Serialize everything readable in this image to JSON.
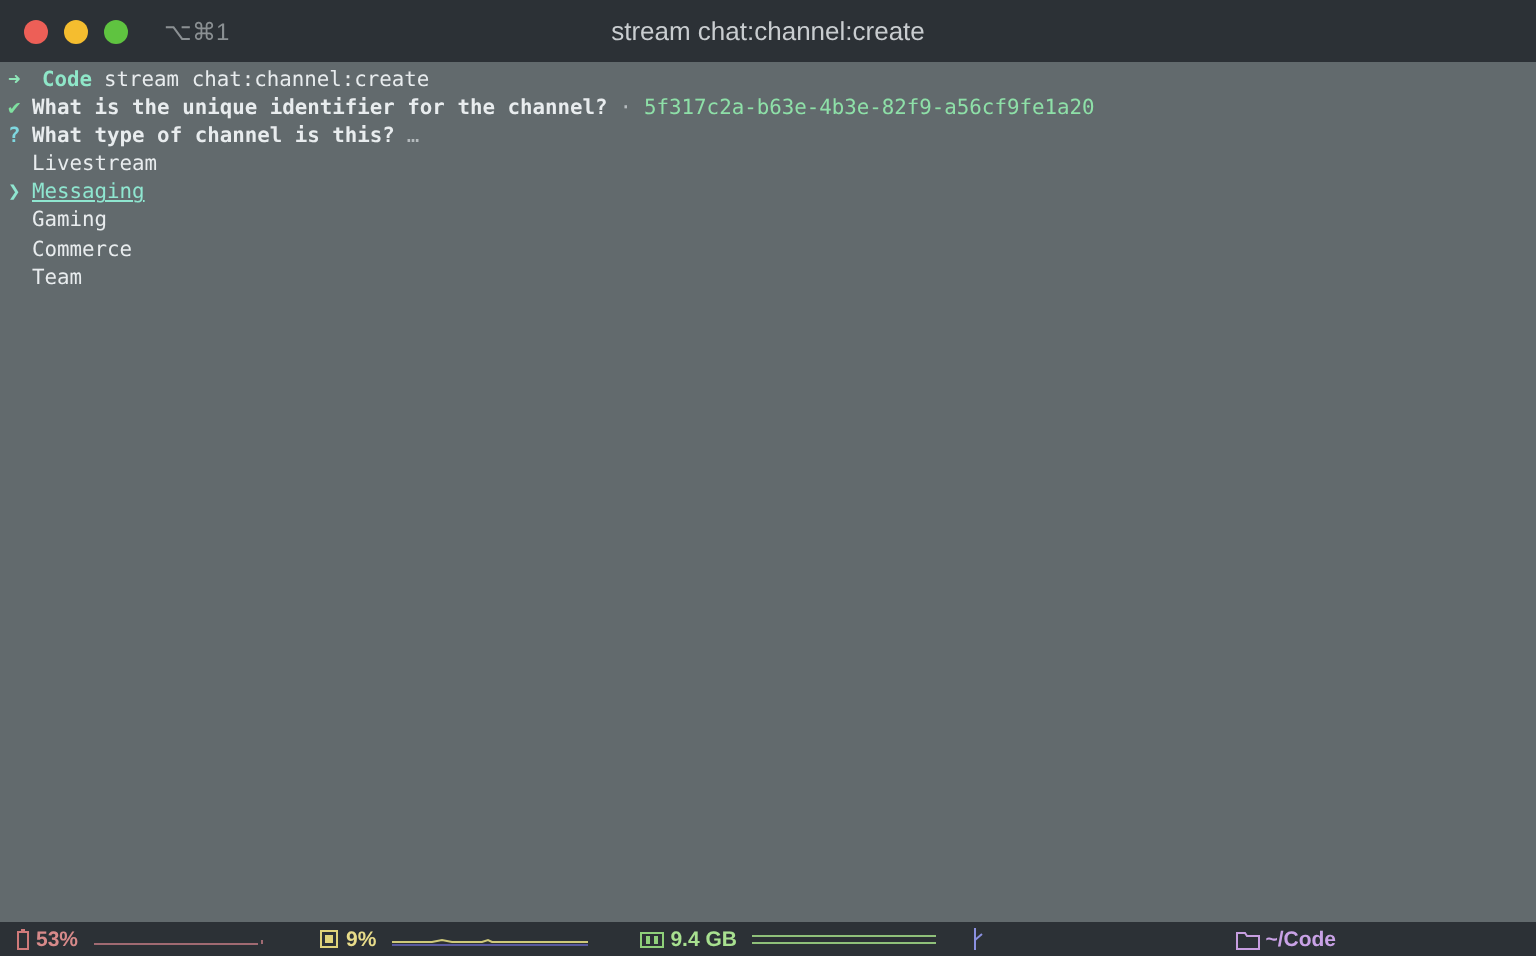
{
  "window": {
    "title": "stream chat:channel:create",
    "shortcut": "⌥⌘1"
  },
  "prompt": {
    "arrow": "➜",
    "directory": "Code",
    "command": "stream chat:channel:create"
  },
  "questions": [
    {
      "kind": "answered",
      "mark": "✔",
      "text": "What is the unique identifier for the channel?",
      "separator": "·",
      "answer": "5f317c2a-b63e-4b3e-82f9-a56cf9fe1a20"
    },
    {
      "kind": "pending",
      "mark": "?",
      "text": "What type of channel is this?",
      "separator": "…"
    }
  ],
  "pointer": "❯",
  "options": [
    {
      "label": "Livestream",
      "selected": false
    },
    {
      "label": "Messaging",
      "selected": true
    },
    {
      "label": "Gaming",
      "selected": false
    },
    {
      "label": "Commerce",
      "selected": false
    },
    {
      "label": "Team",
      "selected": false
    }
  ],
  "status_bar": {
    "battery": "53%",
    "cpu": "9%",
    "memory": "9.4 GB",
    "folder": "~/Code"
  }
}
